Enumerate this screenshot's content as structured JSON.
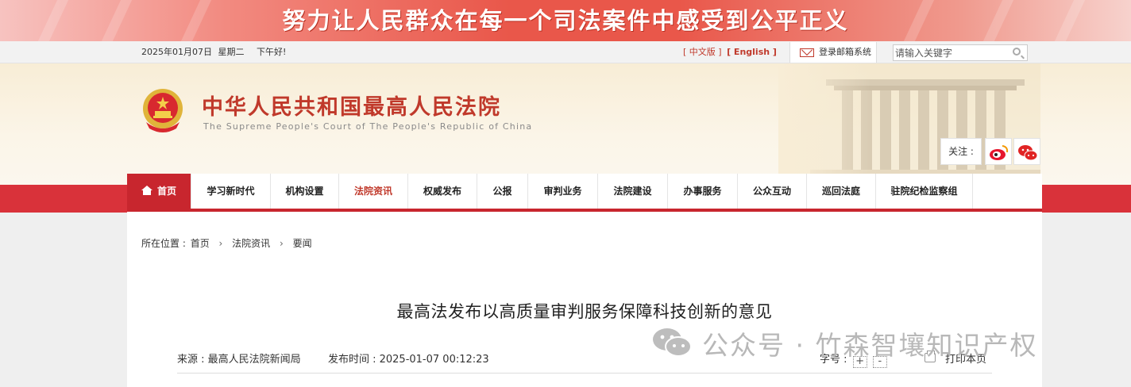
{
  "banner": {
    "slogan": "努力让人民群众在每一个司法案件中感受到公平正义"
  },
  "utility": {
    "date": "2025年01月07日",
    "weekday": "星期二",
    "greeting": "下午好!",
    "lang_cn": "[ 中文版 ]",
    "lang_en": "[ English ]",
    "mailbox": "登录邮箱系统",
    "search_placeholder": "请输入关键字"
  },
  "header": {
    "title": "中华人民共和国最高人民法院",
    "subtitle": "The Supreme People's Court of The People's Republic of China",
    "follow": "关注 :"
  },
  "nav": {
    "items": [
      {
        "label": "首页"
      },
      {
        "label": "学习新时代"
      },
      {
        "label": "机构设置"
      },
      {
        "label": "法院资讯"
      },
      {
        "label": "权威发布"
      },
      {
        "label": "公报"
      },
      {
        "label": "审判业务"
      },
      {
        "label": "法院建设"
      },
      {
        "label": "办事服务"
      },
      {
        "label": "公众互动"
      },
      {
        "label": "巡回法庭"
      },
      {
        "label": "驻院纪检监察组"
      }
    ],
    "active_index": 0,
    "current_index": 3
  },
  "breadcrumb": {
    "prefix": "所在位置 :",
    "items": [
      "首页",
      "法院资讯",
      "要闻"
    ]
  },
  "article": {
    "title": "最高法发布以高质量审判服务保障科技创新的意见",
    "source_label": "来源 :",
    "source": "最高人民法院新闻局",
    "time_label": "发布时间 :",
    "time": "2025-01-07 00:12:23",
    "fontsize_label": "字号 :",
    "fontsize_plus": "+",
    "fontsize_minus": "-",
    "print": "打印本页"
  },
  "watermark": {
    "text": "公众号 · 竹森智壤知识产权"
  },
  "colors": {
    "brand_red": "#c8262e",
    "nav_band": "#d9323a",
    "header_bg": "#f8edd6"
  }
}
